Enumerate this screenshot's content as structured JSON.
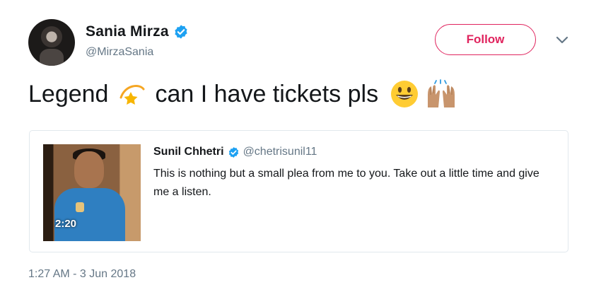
{
  "author": {
    "display_name": "Sania Mirza",
    "handle": "@MirzaSania",
    "verified": true,
    "avatar_icon": "profile-photo"
  },
  "actions": {
    "follow_label": "Follow",
    "more_icon": "chevron-down-icon"
  },
  "tweet": {
    "text_parts": [
      "Legend",
      "can I have tickets pls"
    ],
    "emojis": [
      "dizzy-star-emoji",
      "grinning-face-emoji",
      "raised-hands-emoji"
    ],
    "timestamp": "1:27 AM - 3 Jun 2018"
  },
  "quoted_tweet": {
    "display_name": "Sunil Chhetri",
    "handle": "@chetrisunil11",
    "verified": true,
    "text": "This is nothing but a small plea from me to you. Take out a little time and give me a listen.",
    "video_duration": "2:20"
  },
  "colors": {
    "follow_accent": "#e0245e",
    "verified_blue": "#1da1f2",
    "secondary_text": "#657786",
    "border": "#e1e8ed"
  }
}
